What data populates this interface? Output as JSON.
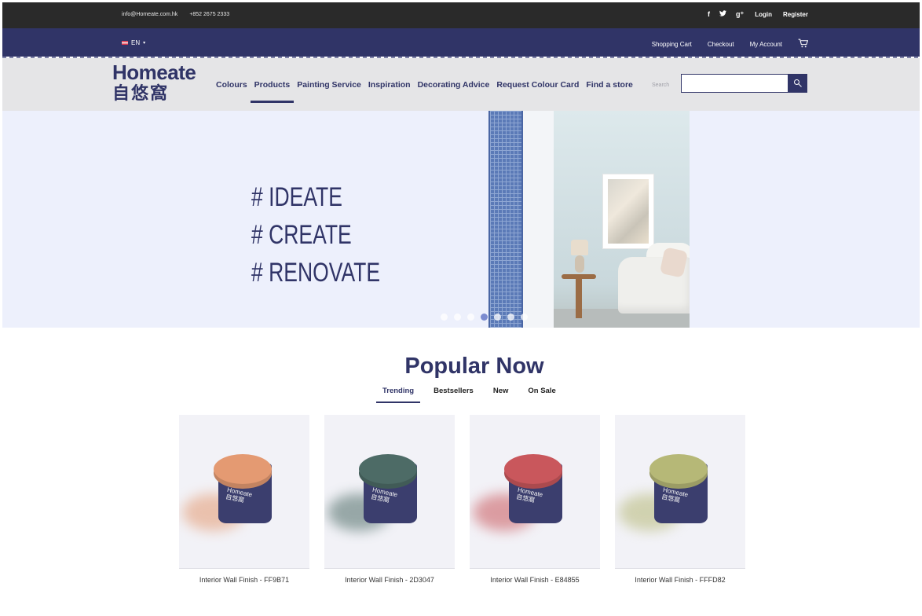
{
  "topbar": {
    "email": "info@Homeate.com.hk",
    "phone": "+852 2675 2333",
    "social": [
      {
        "icon": "facebook-icon",
        "glyph": "f"
      },
      {
        "icon": "twitter-icon",
        "glyph": "🐦"
      },
      {
        "icon": "google-plus-icon",
        "glyph": "g⁺"
      }
    ],
    "login": "Login",
    "register": "Register"
  },
  "navbar": {
    "language": "EN",
    "shopping_cart": "Shopping Cart",
    "checkout": "Checkout",
    "my_account": "My Account",
    "cart_icon": "cart-icon"
  },
  "header": {
    "logo_en": "Homeate",
    "logo_zh": "自悠窩",
    "menu": [
      "Colours",
      "Products",
      "Painting Service",
      "Inspiration",
      "Decorating Advice",
      "Request Colour Card",
      "Find a store"
    ],
    "active_menu": "Products",
    "search_label": "Search",
    "search_value": ""
  },
  "hero": {
    "lines": [
      "# IDEATE",
      "# CREATE",
      "# RENOVATE"
    ],
    "slide_count": 7,
    "active_slide": 4
  },
  "popular": {
    "title": "Popular Now",
    "tabs": [
      "Trending",
      "Bestsellers",
      "New",
      "On Sale"
    ],
    "active_tab": "Trending",
    "products": [
      {
        "name": "Interior Wall Finish - FF9B71",
        "color": "#e49a72"
      },
      {
        "name": "Interior Wall Finish - 2D3047",
        "color": "#4d6b66"
      },
      {
        "name": "Interior Wall Finish - E84855",
        "color": "#c9575c"
      },
      {
        "name": "Interior Wall Finish - FFFD82",
        "color": "#b6b877"
      }
    ],
    "product_brand_en": "Homeate",
    "product_brand_zh": "自悠窩"
  },
  "colors": {
    "brand": "#303467",
    "topbar": "#2a2a2a",
    "hero_bg": "#edf0fc"
  }
}
